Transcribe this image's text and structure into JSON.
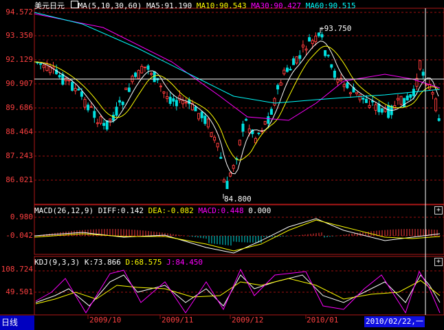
{
  "header": {
    "symbol": "美元日元",
    "ma_label": "MA(5,10,30,60)",
    "ma5": "MA5:91.190",
    "ma10": "MA10:90.543",
    "ma30": "MA30:90.427",
    "ma60": "MA60:90.515"
  },
  "price_axis": [
    "94.572",
    "93.350",
    "92.129",
    "90.907",
    "89.686",
    "88.464",
    "87.243",
    "86.021"
  ],
  "annotations": {
    "high": "93.750",
    "low": "84.800"
  },
  "macd": {
    "label": "MACD(26,12,9)",
    "diff": "DIFF:0.142",
    "dea": "DEA:-0.082",
    "macd": "MACD:0.448",
    "extra": "0.000",
    "axis": [
      "0.980",
      "-0.042"
    ]
  },
  "kdj": {
    "label": "KDJ(9,3,3)",
    "k": "K:73.866",
    "d": "D:68.575",
    "j": "J:84.450",
    "axis": [
      "108.724",
      "49.501"
    ]
  },
  "footer": {
    "period": "日线",
    "dates": [
      "2009/10",
      "2009/11",
      "2009/12",
      "2010/01"
    ],
    "cursor_date": "2010/02/22,一"
  },
  "colors": {
    "up": "#ff3c3c",
    "down": "#00e0e0",
    "ma5": "#ffffff",
    "ma10": "#ffff00",
    "ma30": "#ff00ff",
    "ma60": "#00ff00",
    "grid": "#a01010"
  },
  "icons": {
    "expand": "+"
  }
}
